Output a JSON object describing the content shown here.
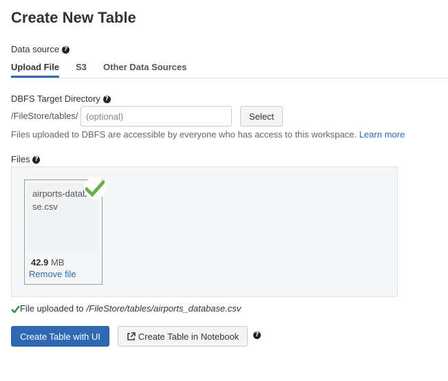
{
  "page": {
    "title": "Create New Table"
  },
  "data_source": {
    "label": "Data source",
    "tabs": [
      {
        "label": "Upload File",
        "active": true
      },
      {
        "label": "S3",
        "active": false
      },
      {
        "label": "Other Data Sources",
        "active": false
      }
    ]
  },
  "target_directory": {
    "label": "DBFS Target Directory",
    "prefix": "/FileStore/tables/",
    "value": "",
    "placeholder": "(optional)",
    "select_label": "Select",
    "info_text": "Files uploaded to DBFS are accessible by everyone who has access to this workspace.",
    "learn_more_label": "Learn more"
  },
  "files": {
    "label": "Files",
    "items": [
      {
        "name": "airports-database.csv",
        "size_value": "42.9",
        "size_unit": "MB",
        "remove_label": "Remove file",
        "uploaded": true
      }
    ]
  },
  "upload_status": {
    "message": "File uploaded to",
    "path": "/FileStore/tables/airports_database.csv"
  },
  "actions": {
    "create_ui_label": "Create Table with UI",
    "create_notebook_label": "Create Table in Notebook"
  },
  "colors": {
    "primary": "#2f69b4",
    "success": "#6ab04c",
    "text": "#333333"
  },
  "icons": {
    "help": "question-circle-icon",
    "check": "check-icon",
    "external": "external-link-icon"
  }
}
